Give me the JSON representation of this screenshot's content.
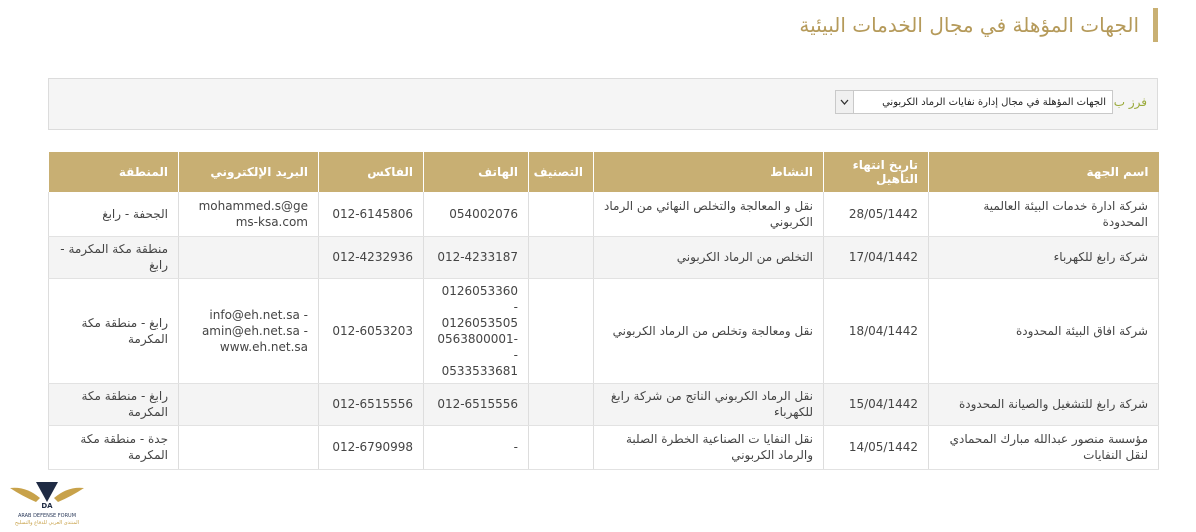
{
  "page": {
    "title": "الجهات المؤهلة في مجال الخدمات البيئية"
  },
  "filter": {
    "label": "فرز ب",
    "selected": "الجهات المؤهلة في مجال إدارة نفايات الرماد الكربوني"
  },
  "table": {
    "headers": {
      "name": "اسم الجهة",
      "expiry": "تاريخ انتهاء التأهيل",
      "activity": "النشاط",
      "category": "التصنيف",
      "phone": "الهاتف",
      "fax": "الفاكس",
      "email": "البريد الإلكتروني",
      "region": "المنطقة"
    },
    "rows": [
      {
        "name": "شركة ادارة خدمات البيئة العالمية المحدودة",
        "expiry": "28/05/1442",
        "activity": "نقل و المعالجة والتخلص النهائي من الرماد الكربوني",
        "category": "",
        "phone": "054002076",
        "fax": "012-6145806",
        "email": "mohammed.s@gems-ksa.com",
        "region": "الجحفة - رابغ"
      },
      {
        "name": "شركة رابغ للكهرباء",
        "expiry": "17/04/1442",
        "activity": "التخلص من الرماد الكربوني",
        "category": "",
        "phone": "012-4233187",
        "fax": "012-4232936",
        "email": "",
        "region": "منطقة مكة المكرمة - رابغ"
      },
      {
        "name": "شركة افاق البيئة المحدودة",
        "expiry": "18/04/1442",
        "activity": "نقل ومعالجة وتخلص من الرماد الكربوني",
        "category": "",
        "phone": "0126053360 -\n0126053505\n0563800001- -\n0533533681",
        "fax": "012-6053203",
        "email": "info@eh.net.sa -\namin@eh.net.sa -\nwww.eh.net.sa",
        "region": "رابغ - منطقة مكة المكرمة"
      },
      {
        "name": "شركة رابغ للتشغيل والصيانة المحدودة",
        "expiry": "15/04/1442",
        "activity": "نقل الرماد الكربوني الناتج من شركة رابغ للكهرباء",
        "category": "",
        "phone": "012-6515556",
        "fax": "012-6515556",
        "email": "",
        "region": "رابغ - منطقة مكة المكرمة"
      },
      {
        "name": "مؤسسة منصور عبدالله مبارك المحمادي لنقل النفايات",
        "expiry": "14/05/1442",
        "activity": "نقل النفايا ت الصناعية الخطرة الصلبة والرماد الكربوني",
        "category": "",
        "phone": "-",
        "fax": "012-6790998",
        "email": "",
        "region": "جدة - منطقة مكة المكرمة"
      }
    ]
  },
  "watermark": {
    "initials": "DA",
    "text": "ARAB DEFENSE FORUM",
    "subtext": "المنتدى العربي للدفاع والتسليح"
  },
  "colors": {
    "accent": "#c8af73",
    "title": "#b59a5a",
    "filter_label": "#9aaa3a"
  }
}
